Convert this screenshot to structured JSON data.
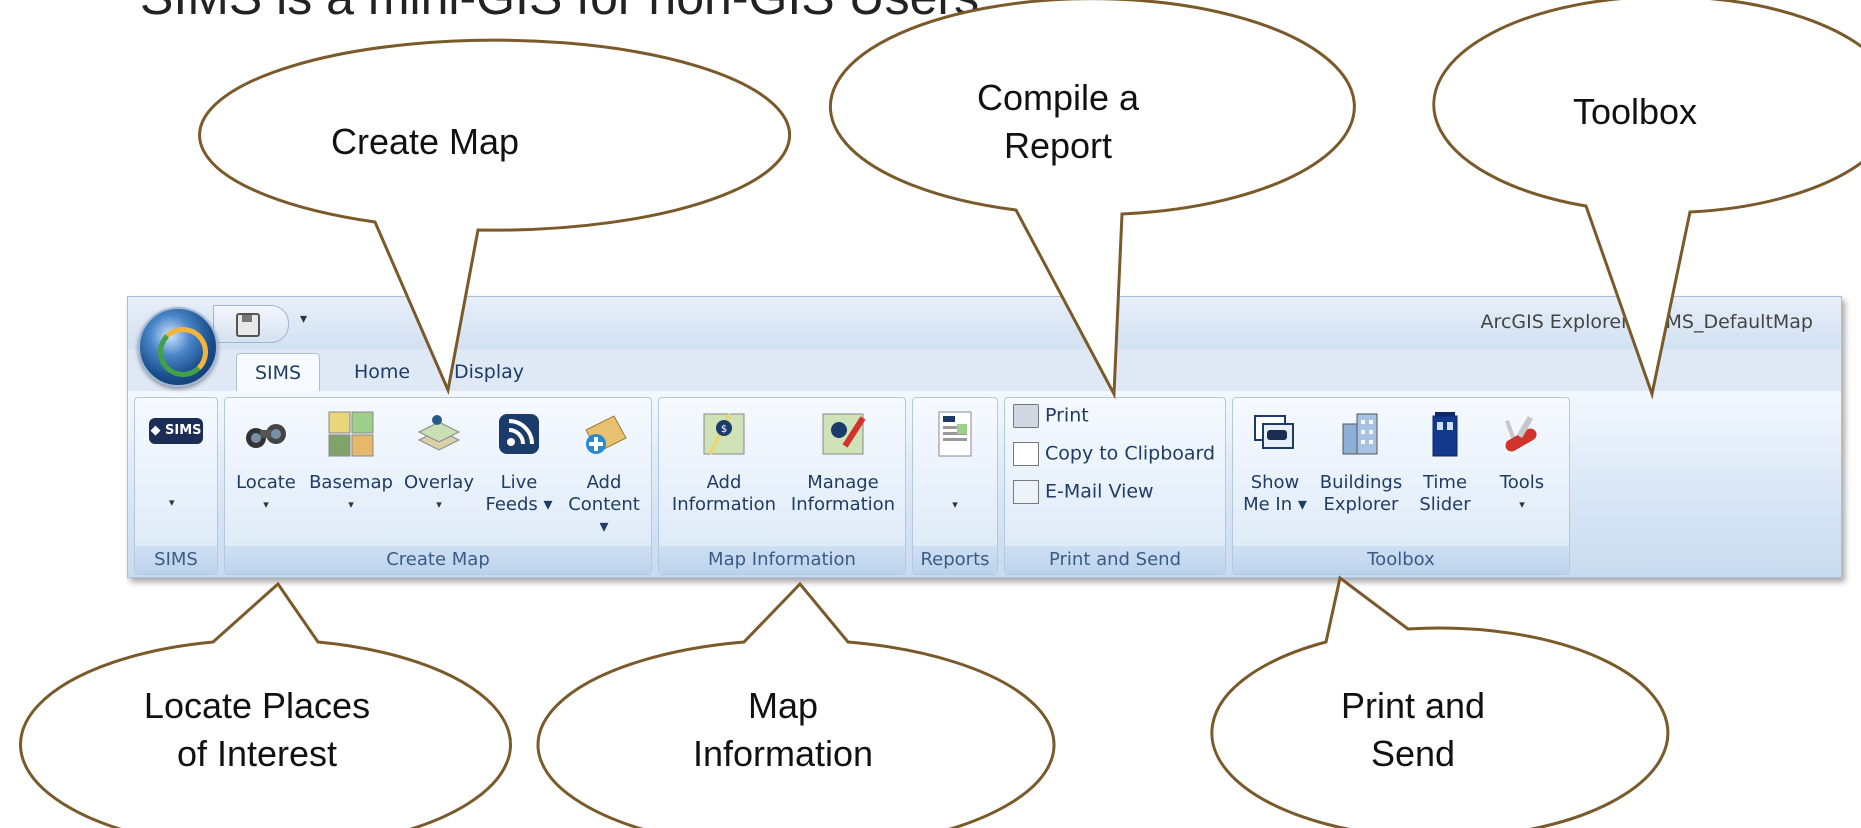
{
  "heading": "SIMS is a mini-GIS for non-GIS Users.",
  "window_title": "ArcGIS Explorer - SIMS_DefaultMap",
  "tabs": [
    "SIMS",
    "Home",
    "Display"
  ],
  "groups": {
    "sims": {
      "label": "SIMS",
      "logo_text": "SIMS"
    },
    "create_map": {
      "label": "Create Map",
      "buttons": [
        "Locate",
        "Basemap",
        "Overlay",
        "Live\nFeeds ▾",
        "Add\nContent ▾"
      ]
    },
    "map_information": {
      "label": "Map Information",
      "buttons": [
        "Add\nInformation",
        "Manage\nInformation"
      ]
    },
    "reports": {
      "label": "Reports"
    },
    "print_send": {
      "label": "Print and Send",
      "buttons": [
        "Print",
        "Copy to Clipboard",
        "E-Mail View"
      ]
    },
    "toolbox": {
      "label": "Toolbox",
      "buttons": [
        "Show\nMe In ▾",
        "Buildings\nExplorer",
        "Time\nSlider",
        "Tools"
      ]
    }
  },
  "callouts": {
    "create_map": "Create Map",
    "compile_report": "Compile a\nReport",
    "toolbox": "Toolbox",
    "locate_places": "Locate Places\nof Interest",
    "map_information": "Map\nInformation",
    "print_send": "Print and\nSend"
  }
}
